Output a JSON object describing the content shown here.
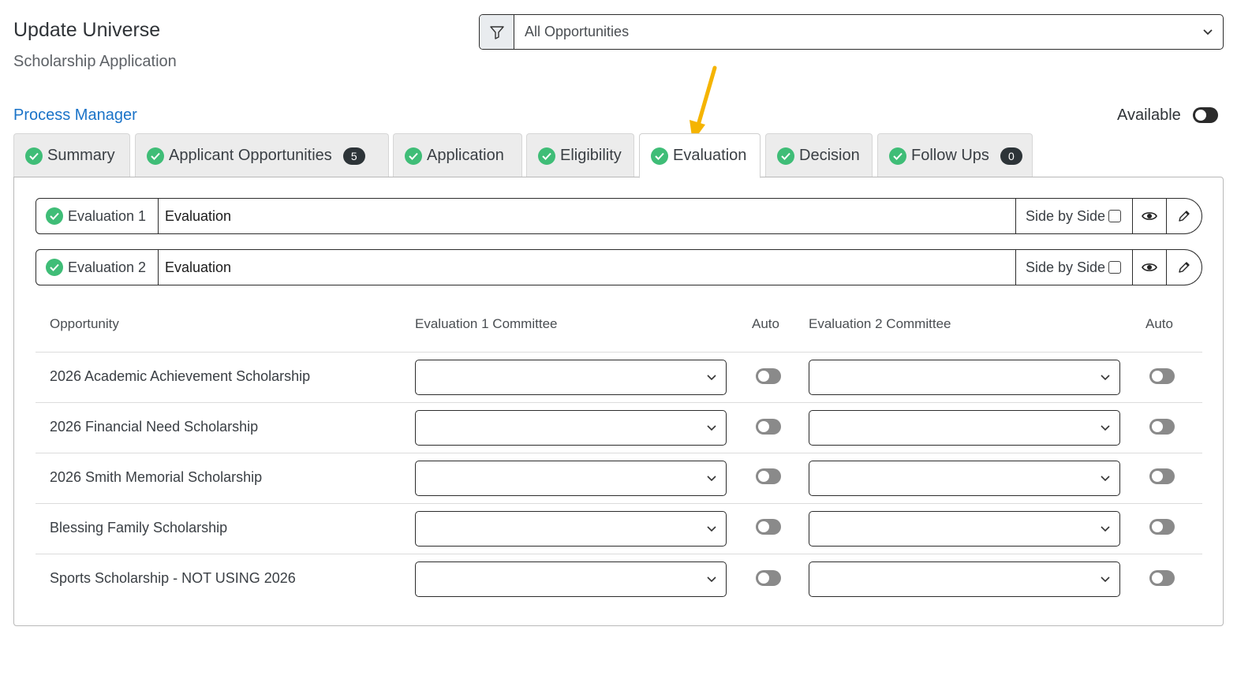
{
  "header": {
    "title": "Update Universe",
    "subtitle": "Scholarship Application",
    "filter_value": "All Opportunities"
  },
  "process_manager_link": "Process Manager",
  "available": {
    "label": "Available",
    "on": false
  },
  "tabs": [
    {
      "label": "Summary",
      "checked": true
    },
    {
      "label": "Applicant Opportunities",
      "checked": true,
      "badge": "5"
    },
    {
      "label": "Application",
      "checked": true
    },
    {
      "label": "Eligibility",
      "checked": true
    },
    {
      "label": "Evaluation",
      "checked": true,
      "active": true
    },
    {
      "label": "Decision",
      "checked": true
    },
    {
      "label": "Follow Ups",
      "checked": true,
      "badge": "0"
    }
  ],
  "evaluations": [
    {
      "label": "Evaluation 1",
      "name": "Evaluation",
      "side_by_side": "Side by Side"
    },
    {
      "label": "Evaluation 2",
      "name": "Evaluation",
      "side_by_side": "Side by Side"
    }
  ],
  "table": {
    "headers": {
      "opportunity": "Opportunity",
      "committee1": "Evaluation 1 Committee",
      "auto1": "Auto",
      "committee2": "Evaluation 2 Committee",
      "auto2": "Auto"
    },
    "rows": [
      {
        "opportunity": "2026 Academic Achievement Scholarship"
      },
      {
        "opportunity": "2026 Financial Need Scholarship"
      },
      {
        "opportunity": "2026 Smith Memorial Scholarship"
      },
      {
        "opportunity": "Blessing Family Scholarship"
      },
      {
        "opportunity": "Sports Scholarship - NOT USING 2026"
      }
    ]
  },
  "colors": {
    "check_green": "#3fbd77",
    "link_blue": "#1a73c8",
    "arrow_orange": "#f5b400"
  },
  "icons": [
    "filter-icon",
    "chevron-down-icon",
    "check-icon",
    "eye-icon",
    "pencil-icon"
  ]
}
